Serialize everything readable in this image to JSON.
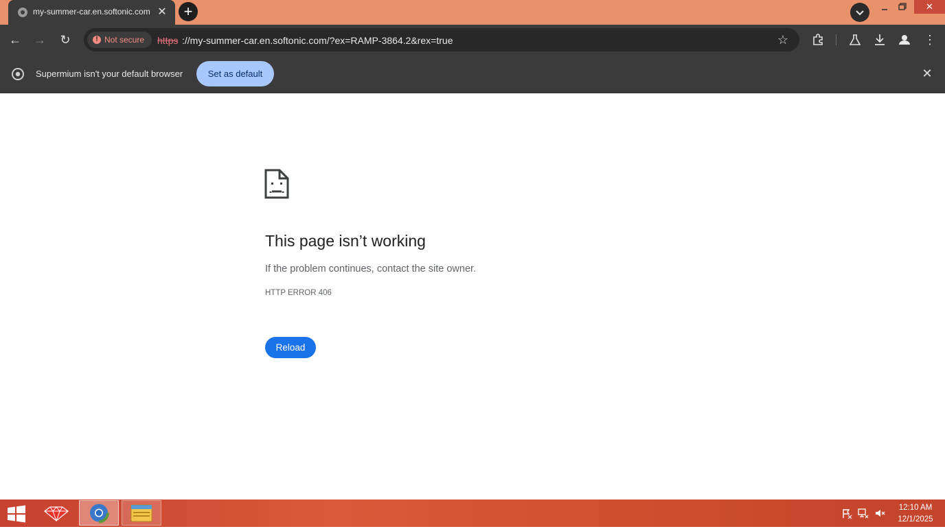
{
  "browser": {
    "tab": {
      "title": "my-summer-car.en.softonic.com",
      "close_glyph": "✕",
      "favicon": "globe-icon"
    },
    "new_tab_glyph": "+",
    "window_controls": {
      "close_glyph": "✕"
    },
    "toolbar": {
      "back_glyph": "←",
      "forward_glyph": "→",
      "reload_glyph": "↻",
      "security_label": "Not secure",
      "url_scheme": "https",
      "url_rest": "://my-summer-car.en.softonic.com/?ex=RAMP-3864.2&rex=true",
      "star_glyph": "☆",
      "menu_glyph": "⋮"
    },
    "infobar": {
      "message": "Supermium isn't your default browser",
      "button_label": "Set as default",
      "close_glyph": "✕"
    }
  },
  "page": {
    "icon": "sad-page-icon",
    "title": "This page isn’t working",
    "description": "If the problem continues, contact the site owner.",
    "error_code": "HTTP ERROR 406",
    "reload_label": "Reload"
  },
  "taskbar": {
    "apps": [
      "ruby-app-icon",
      "chrome-like-browser-icon",
      "file-explorer-icon"
    ],
    "time": "12:10 AM",
    "date": "12/1/2025"
  },
  "colors": {
    "titlebar": "#e8916a",
    "toolbar": "#3b3b3b",
    "accent_button": "#a8c7fa",
    "reload_button": "#1a73e8",
    "taskbar": "#c8402f"
  }
}
